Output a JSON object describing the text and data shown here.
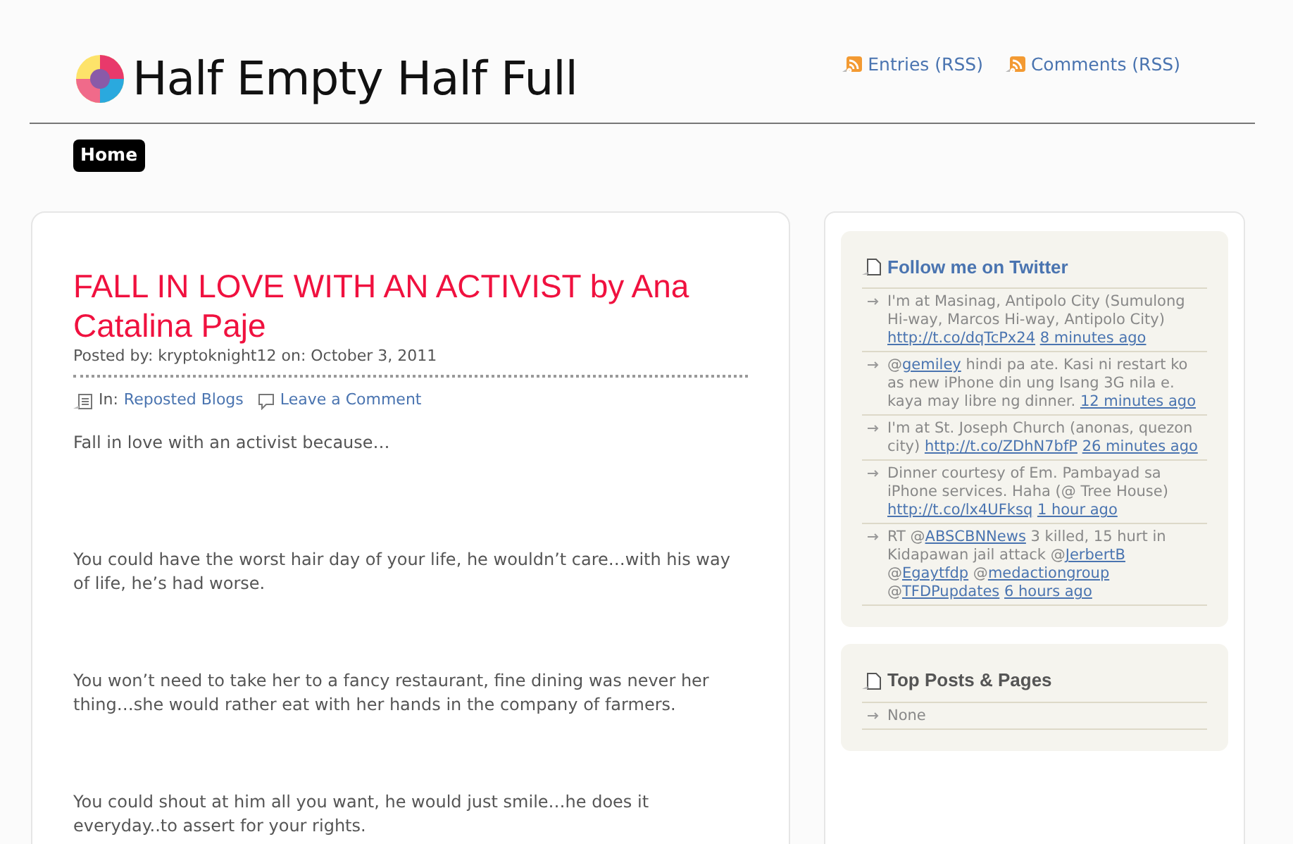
{
  "header": {
    "site_title": "Half Empty Half Full",
    "feeds": [
      "Entries (RSS)",
      "Comments (RSS)"
    ]
  },
  "nav": [
    {
      "label": "Home",
      "selected": true
    }
  ],
  "post": {
    "title": "FALL IN LOVE WITH AN ACTIVIST by Ana Catalina Paje",
    "byline": "Posted by: kryptoknight12 on: October 3, 2011",
    "category_label": "In:",
    "category": "Reposted Blogs",
    "comment_link": "Leave a Comment",
    "paragraphs": [
      "Fall in love with an activist because…",
      "You could have the worst hair day of your life, he wouldn’t care…with his way of life, he’s had worse.",
      "You won’t need to take her to a fancy restaurant, fine dining was never her thing…she would rather eat  with her hands in the company of farmers.",
      "You could shout at him all you want, he would just smile…he does it everyday..to assert for your rights."
    ]
  },
  "sidebar": [
    {
      "title": "Follow me on Twitter",
      "kind": "link",
      "items": [
        [
          {
            "text": "I'm at Masinag, Antipolo City (Sumulong Hi-way, Marcos Hi-way, Antipolo City) ",
            "kind": "text"
          },
          {
            "text": "http://t.co/dqTcPx24",
            "kind": "link"
          },
          {
            "text": "8 minutes ago",
            "kind": "link"
          }
        ],
        [
          {
            "text": "@",
            "kind": "text"
          },
          {
            "text": "gemiley",
            "kind": "link"
          },
          {
            "text": " hindi pa ate. Kasi ni restart ko as new iPhone din ung Isang 3G nila e. kaya may libre ng dinner. ",
            "kind": "text"
          },
          {
            "text": "12 minutes ago",
            "kind": "link"
          }
        ],
        [
          {
            "text": "I'm at St. Joseph Church (anonas, quezon city) ",
            "kind": "text"
          },
          {
            "text": "http://t.co/ZDhN7bfP",
            "kind": "link"
          },
          {
            "text": "26 minutes ago",
            "kind": "link"
          }
        ],
        [
          {
            "text": "Dinner courtesy of Em. Pambayad sa iPhone services. Haha (@ Tree House) ",
            "kind": "text"
          },
          {
            "text": "http://t.co/lx4UFksq",
            "kind": "link"
          },
          {
            "text": "1 hour ago",
            "kind": "link"
          }
        ],
        [
          {
            "text": "RT @",
            "kind": "text"
          },
          {
            "text": "ABSCBNNews",
            "kind": "link"
          },
          {
            "text": " 3 killed, 15 hurt in Kidapawan jail attack @",
            "kind": "text"
          },
          {
            "text": "JerbertB",
            "kind": "link"
          },
          {
            "text": " @",
            "kind": "text"
          },
          {
            "text": "Egaytfdp",
            "kind": "link"
          },
          {
            "text": " @",
            "kind": "text"
          },
          {
            "text": "medactiongroup",
            "kind": "link"
          },
          {
            "text": " @",
            "kind": "text"
          },
          {
            "text": "TFDPupdates",
            "kind": "link"
          },
          {
            "text": "6 hours ago",
            "kind": "link"
          }
        ]
      ]
    },
    {
      "title": "Top Posts & Pages",
      "kind": "plain",
      "items": [
        [
          {
            "text": "None",
            "kind": "text"
          }
        ]
      ]
    }
  ]
}
